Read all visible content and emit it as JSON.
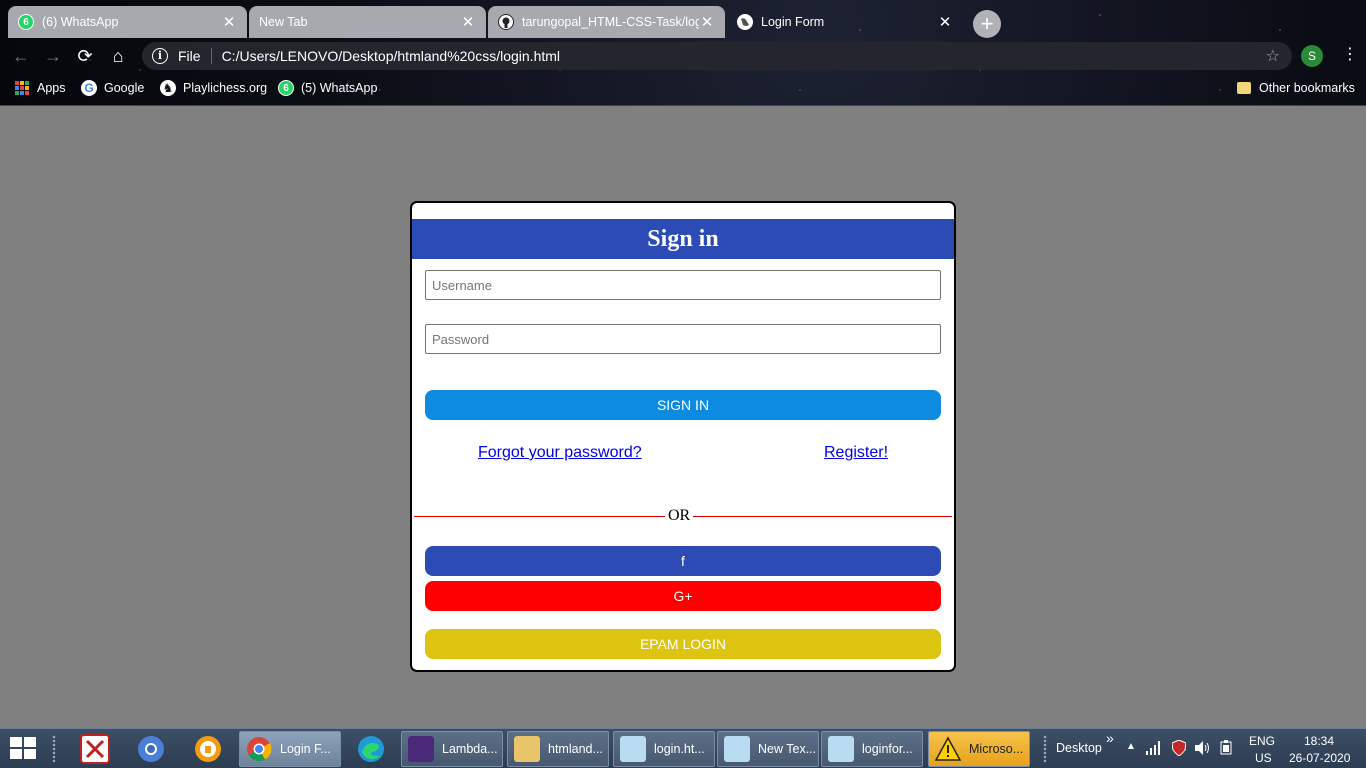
{
  "browser": {
    "tabs": [
      {
        "title": "(6) WhatsApp",
        "badge": "6",
        "active": false
      },
      {
        "title": "New Tab",
        "active": false
      },
      {
        "title": "tarungopal_HTML-CSS-Task/logi",
        "active": false
      },
      {
        "title": "Login Form",
        "active": true
      }
    ],
    "new_tab_label": "+",
    "address": {
      "scheme_label": "File",
      "url": "C:/Users/LENOVO/Desktop/htmland%20css/login.html"
    },
    "profile_initial": "S",
    "bookmarks": [
      {
        "label": "Apps",
        "icon": "apps-grid-icon"
      },
      {
        "label": "Google",
        "icon": "google-icon"
      },
      {
        "label": "Playlichess.org",
        "icon": "lichess-icon"
      },
      {
        "label": "(5) WhatsApp",
        "icon": "whatsapp-icon",
        "badge": "6"
      }
    ],
    "other_bookmarks": "Other bookmarks"
  },
  "login": {
    "title": "Sign in",
    "username_placeholder": "Username",
    "password_placeholder": "Password",
    "signin_label": "SIGN IN",
    "forgot_label": "Forgot your password?",
    "register_label": "Register!",
    "or_label": "OR",
    "facebook_label": "f",
    "google_label": "G+",
    "epam_label": "EPAM LOGIN",
    "colors": {
      "header": "#2d4bb4",
      "signin": "#0d8be1",
      "facebook": "#2d4bb4",
      "google": "#ff0000",
      "epam": "#dcc411",
      "divider": "#e00000"
    }
  },
  "taskbar": {
    "items": [
      {
        "label": "Login F...",
        "icon": "chrome-icon",
        "active": true
      },
      {
        "label": "Lambda...",
        "icon": "java-ide-icon"
      },
      {
        "label": "htmland...",
        "icon": "folder-icon"
      },
      {
        "label": "login.ht...",
        "icon": "notepad-icon"
      },
      {
        "label": "New Tex...",
        "icon": "notepad-icon"
      },
      {
        "label": "loginfor...",
        "icon": "notepad-icon"
      },
      {
        "label": "Microso...",
        "icon": "warning-icon"
      }
    ],
    "desktop_label": "Desktop",
    "chevron": "»",
    "lang": "ENG",
    "region": "US",
    "time": "18:34",
    "date": "26-07-2020"
  }
}
